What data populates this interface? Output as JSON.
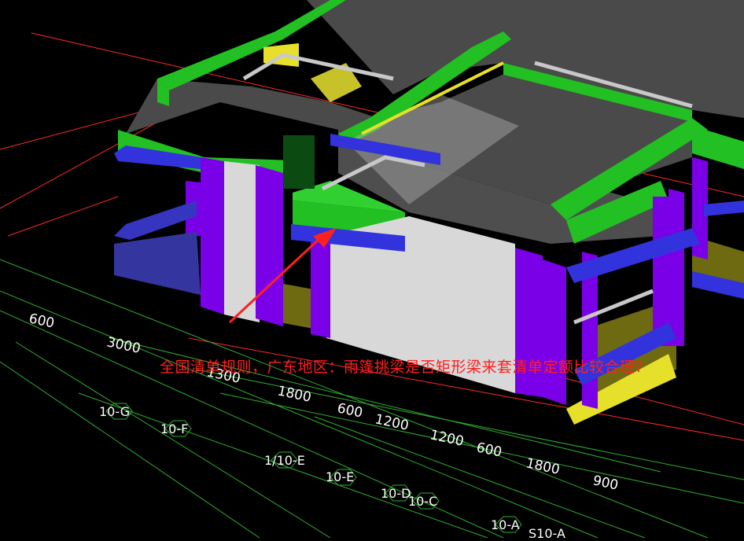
{
  "question": "全国清单规则，广东地区：雨篷挑梁是否矩形梁来套清单定额比较合理?",
  "dimensions": [
    "600",
    "3000",
    "1300",
    "1800",
    "600",
    "1200",
    "1200",
    "600",
    "1800",
    "900"
  ],
  "axes": [
    "10-G",
    "10-F",
    "1/10-E",
    "10-E",
    "10-D",
    "10-C",
    "10-A",
    "S10-A"
  ],
  "colors": {
    "background": "#000000",
    "slab": "#4a4a4a",
    "beam_green": "#22c022",
    "column_purple": "#7a00e8",
    "beam_blue": "#3333dd",
    "wall_white": "#d8d8d8",
    "beam_yellow": "#e6e02a",
    "grid_red": "#ff2a2a",
    "grid_green": "#2fae2f",
    "annotation_red": "#ff2020"
  }
}
